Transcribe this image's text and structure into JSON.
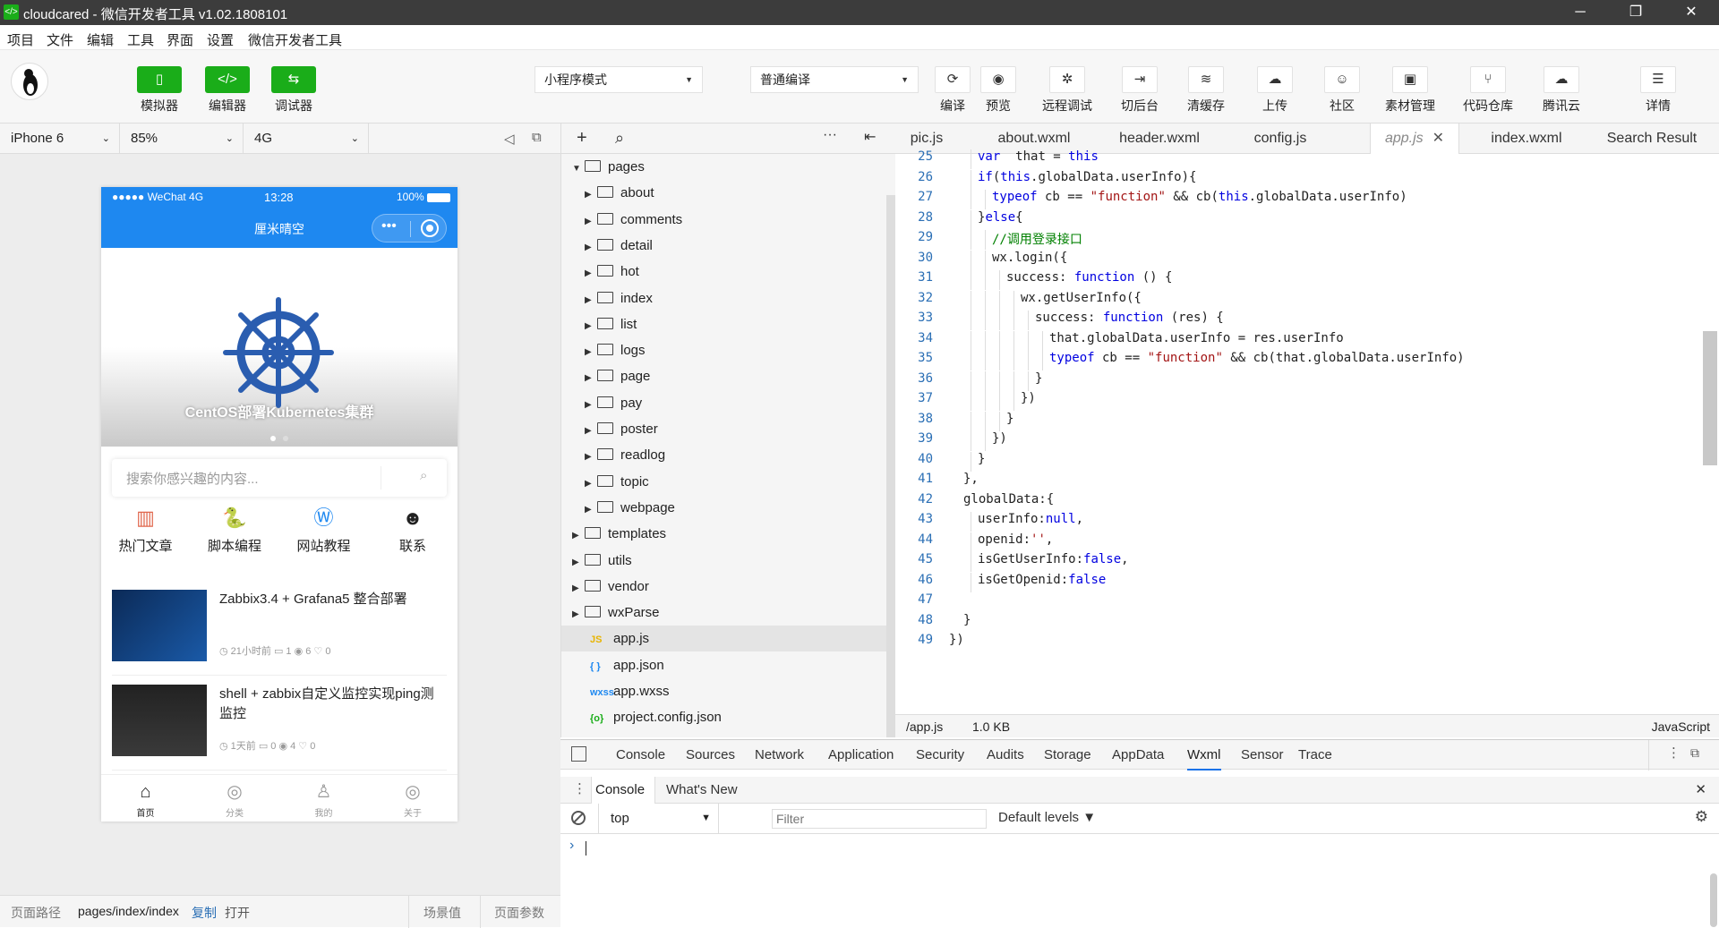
{
  "window": {
    "title": "cloudcared - 微信开发者工具 v1.02.1808101",
    "min": "─",
    "max": "❐",
    "close": "✕"
  },
  "menu": [
    "项目",
    "文件",
    "编辑",
    "工具",
    "界面",
    "设置",
    "微信开发者工具"
  ],
  "toolbar": {
    "left_buttons": [
      {
        "label": "模拟器",
        "icon": "phone-icon",
        "glyph": "▯"
      },
      {
        "label": "编辑器",
        "icon": "code-icon",
        "glyph": "</>"
      },
      {
        "label": "调试器",
        "icon": "debug-icon",
        "glyph": "⇆"
      }
    ],
    "mode_select": "小程序模式",
    "compile_select": "普通编译",
    "right_buttons": [
      {
        "label": "编译",
        "icon": "refresh-icon",
        "glyph": "⟳"
      },
      {
        "label": "预览",
        "icon": "eye-icon",
        "glyph": "◉"
      },
      {
        "label": "远程调试",
        "icon": "bug-icon",
        "glyph": "✲"
      },
      {
        "label": "切后台",
        "icon": "switch-icon",
        "glyph": "⇥"
      },
      {
        "label": "清缓存",
        "icon": "layers-icon",
        "glyph": "≋"
      },
      {
        "label": "上传",
        "icon": "upload-icon",
        "glyph": "☁"
      },
      {
        "label": "社区",
        "icon": "chat-icon",
        "glyph": "☺"
      },
      {
        "label": "素材管理",
        "icon": "material-icon",
        "glyph": "▣"
      },
      {
        "label": "代码仓库",
        "icon": "branch-icon",
        "glyph": "⑂"
      },
      {
        "label": "腾讯云",
        "icon": "cloud-icon",
        "glyph": "☁"
      },
      {
        "label": "详情",
        "icon": "menu-icon",
        "glyph": "☰"
      }
    ]
  },
  "simulator": {
    "device": "iPhone 6",
    "zoom": "85%",
    "network": "4G",
    "status": {
      "carrier": "●●●●● WeChat 4G",
      "time": "13:28",
      "battery": "100%"
    },
    "nav_title": "厘米晴空",
    "banner_caption": "CentOS部署Kubernetes集群",
    "search_placeholder": "搜索你感兴趣的内容...",
    "categories": [
      {
        "label": "热门文章",
        "glyph": "▥",
        "color": "#e0664b"
      },
      {
        "label": "脚本编程",
        "glyph": "🐍",
        "color": "#222222"
      },
      {
        "label": "网站教程",
        "glyph": "Ⓦ",
        "color": "#1e88f0"
      },
      {
        "label": "联系",
        "glyph": "☻",
        "color": "#222222"
      }
    ],
    "posts": [
      {
        "title": "Zabbix3.4 + Grafana5 整合部署",
        "time": "21小时前",
        "comments": "1",
        "views": "6",
        "likes": "0"
      },
      {
        "title": "shell + zabbix自定义监控实现ping测监控",
        "time": "1天前",
        "comments": "0",
        "views": "4",
        "likes": "0"
      }
    ],
    "tabs": [
      {
        "label": "首页",
        "glyph": "⌂"
      },
      {
        "label": "分类",
        "glyph": "◎"
      },
      {
        "label": "我的",
        "glyph": "♙"
      },
      {
        "label": "关于",
        "glyph": "◎"
      }
    ],
    "footer": {
      "path_label": "页面路径",
      "path": "pages/index/index",
      "copy": "复制",
      "open": "打开",
      "scene": "场景值",
      "params": "页面参数"
    }
  },
  "filetree": {
    "items": [
      {
        "name": "pages",
        "type": "folder",
        "level": 0,
        "open": true
      },
      {
        "name": "about",
        "type": "folder",
        "level": 1
      },
      {
        "name": "comments",
        "type": "folder",
        "level": 1
      },
      {
        "name": "detail",
        "type": "folder",
        "level": 1
      },
      {
        "name": "hot",
        "type": "folder",
        "level": 1
      },
      {
        "name": "index",
        "type": "folder",
        "level": 1
      },
      {
        "name": "list",
        "type": "folder",
        "level": 1
      },
      {
        "name": "logs",
        "type": "folder",
        "level": 1
      },
      {
        "name": "page",
        "type": "folder",
        "level": 1
      },
      {
        "name": "pay",
        "type": "folder",
        "level": 1
      },
      {
        "name": "poster",
        "type": "folder",
        "level": 1
      },
      {
        "name": "readlog",
        "type": "folder",
        "level": 1
      },
      {
        "name": "topic",
        "type": "folder",
        "level": 1
      },
      {
        "name": "webpage",
        "type": "folder",
        "level": 1
      },
      {
        "name": "templates",
        "type": "folder",
        "level": 0
      },
      {
        "name": "utils",
        "type": "folder",
        "level": 0
      },
      {
        "name": "vendor",
        "type": "folder",
        "level": 0
      },
      {
        "name": "wxParse",
        "type": "folder",
        "level": 0
      },
      {
        "name": "app.js",
        "type": "file",
        "level": 0,
        "badge": "JS",
        "badge_color": "#e8b400",
        "selected": true
      },
      {
        "name": "app.json",
        "type": "file",
        "level": 0,
        "badge": "{ }",
        "badge_color": "#1e88f0"
      },
      {
        "name": "app.wxss",
        "type": "file",
        "level": 0,
        "badge": "wxss",
        "badge_color": "#1e88f0"
      },
      {
        "name": "project.config.json",
        "type": "file",
        "level": 0,
        "badge": "{o}",
        "badge_color": "#1aad19"
      }
    ]
  },
  "editor_tabs": [
    {
      "label": "pic.js"
    },
    {
      "label": "about.wxml"
    },
    {
      "label": "header.wxml"
    },
    {
      "label": "config.js"
    },
    {
      "label": "app.js",
      "active": true
    },
    {
      "label": "index.wxml"
    },
    {
      "label": "Search Result"
    }
  ],
  "code_lines": [
    {
      "n": "25",
      "i": 2,
      "t": [
        [
          "kw",
          "var"
        ],
        [
          "",
          "  that = "
        ],
        [
          "kw",
          "this"
        ]
      ]
    },
    {
      "n": "26",
      "i": 2,
      "t": [
        [
          "kw",
          "if"
        ],
        [
          "",
          "("
        ],
        [
          "kw",
          "this"
        ],
        [
          "",
          ".globalData.userInfo){"
        ]
      ]
    },
    {
      "n": "27",
      "i": 3,
      "t": [
        [
          "kw",
          "typeof"
        ],
        [
          "",
          " cb == "
        ],
        [
          "str",
          "\"function\""
        ],
        [
          "",
          " && cb("
        ],
        [
          "kw",
          "this"
        ],
        [
          "",
          ".globalData.userInfo)"
        ]
      ]
    },
    {
      "n": "28",
      "i": 2,
      "t": [
        [
          "",
          "}"
        ],
        [
          "kw",
          "else"
        ],
        [
          "",
          "{"
        ]
      ]
    },
    {
      "n": "29",
      "i": 3,
      "t": [
        [
          "cm",
          "//调用登录接口"
        ]
      ]
    },
    {
      "n": "30",
      "i": 3,
      "t": [
        [
          "",
          "wx.login({"
        ]
      ]
    },
    {
      "n": "31",
      "i": 4,
      "t": [
        [
          "",
          "success: "
        ],
        [
          "kw",
          "function"
        ],
        [
          "",
          " () {"
        ]
      ]
    },
    {
      "n": "32",
      "i": 5,
      "t": [
        [
          "",
          "wx.getUserInfo({"
        ]
      ]
    },
    {
      "n": "33",
      "i": 6,
      "t": [
        [
          "",
          "success: "
        ],
        [
          "kw",
          "function"
        ],
        [
          "",
          " (res) {"
        ]
      ]
    },
    {
      "n": "34",
      "i": 7,
      "t": [
        [
          "",
          "that.globalData.userInfo = res.userInfo"
        ]
      ]
    },
    {
      "n": "35",
      "i": 7,
      "t": [
        [
          "kw",
          "typeof"
        ],
        [
          "",
          " cb == "
        ],
        [
          "str",
          "\"function\""
        ],
        [
          "",
          " && cb(that.globalData.userInfo)"
        ]
      ]
    },
    {
      "n": "36",
      "i": 6,
      "t": [
        [
          "",
          "}"
        ]
      ]
    },
    {
      "n": "37",
      "i": 5,
      "t": [
        [
          "",
          "})"
        ]
      ]
    },
    {
      "n": "38",
      "i": 4,
      "t": [
        [
          "",
          "}"
        ]
      ]
    },
    {
      "n": "39",
      "i": 3,
      "t": [
        [
          "",
          "})"
        ]
      ]
    },
    {
      "n": "40",
      "i": 2,
      "t": [
        [
          "",
          "}"
        ]
      ]
    },
    {
      "n": "41",
      "i": 1,
      "t": [
        [
          "",
          "},"
        ]
      ]
    },
    {
      "n": "42",
      "i": 1,
      "t": [
        [
          "",
          "globalData:{"
        ]
      ]
    },
    {
      "n": "43",
      "i": 2,
      "t": [
        [
          "",
          "userInfo:"
        ],
        [
          "kw",
          "null"
        ],
        [
          "",
          ","
        ]
      ]
    },
    {
      "n": "44",
      "i": 2,
      "t": [
        [
          "",
          "openid:"
        ],
        [
          "str",
          "''"
        ],
        [
          "",
          ","
        ]
      ]
    },
    {
      "n": "45",
      "i": 2,
      "t": [
        [
          "",
          "isGetUserInfo:"
        ],
        [
          "kw",
          "false"
        ],
        [
          "",
          ","
        ]
      ]
    },
    {
      "n": "46",
      "i": 2,
      "t": [
        [
          "",
          "isGetOpenid:"
        ],
        [
          "kw",
          "false"
        ]
      ]
    },
    {
      "n": "47",
      "i": 0,
      "t": [
        [
          "",
          ""
        ]
      ]
    },
    {
      "n": "48",
      "i": 1,
      "t": [
        [
          "",
          "}"
        ]
      ]
    },
    {
      "n": "49",
      "i": 0,
      "t": [
        [
          "",
          "})"
        ]
      ]
    }
  ],
  "editor_status": {
    "path": "/app.js",
    "size": "1.0 KB",
    "lang": "JavaScript"
  },
  "devtools": {
    "tabs": [
      "Console",
      "Sources",
      "Network",
      "Application",
      "Security",
      "Audits",
      "Storage",
      "AppData",
      "Wxml",
      "Sensor",
      "Trace"
    ],
    "active": "Wxml",
    "drawer_tabs": [
      "Console",
      "What's New"
    ],
    "context": "top",
    "filter_placeholder": "Filter",
    "levels": "Default levels ▼",
    "prompt": "›"
  }
}
